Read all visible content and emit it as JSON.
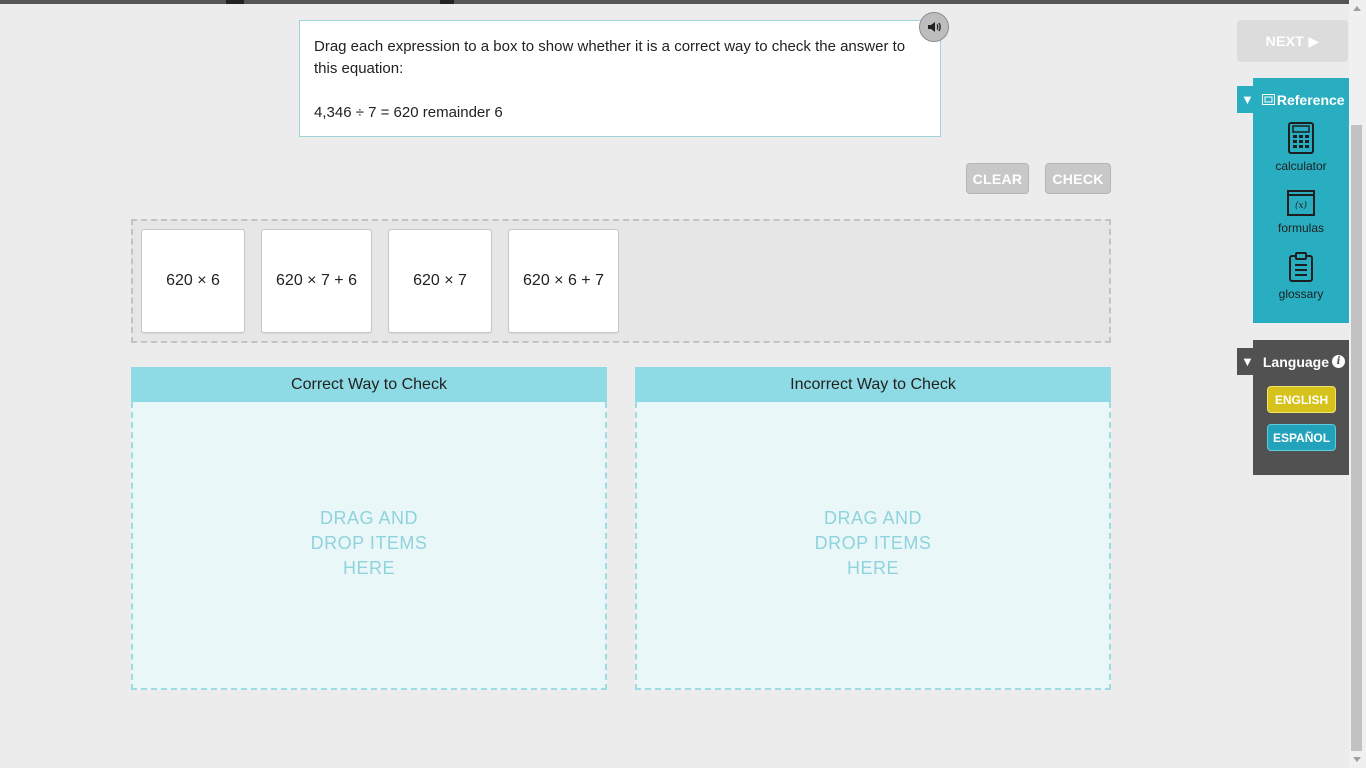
{
  "prompt": {
    "instruction": "Drag each expression to a box to show whether it is a correct way to check the answer to this equation:",
    "equation": "4,346 ÷ 7 = 620 remainder 6"
  },
  "toolbar": {
    "clear_label": "CLEAR",
    "check_label": "CHECK",
    "next_label": "NEXT ▶"
  },
  "tiles": [
    "620 × 6",
    "620 × 7 + 6",
    "620 × 7",
    "620 × 6 + 7"
  ],
  "zones": {
    "correct": {
      "title": "Correct Way to Check",
      "hint": "DRAG AND DROP ITEMS HERE"
    },
    "incorrect": {
      "title": "Incorrect Way to Check",
      "hint": "DRAG AND DROP ITEMS HERE"
    }
  },
  "reference": {
    "title": "Reference",
    "items": [
      {
        "label": "calculator",
        "icon": "calculator-icon"
      },
      {
        "label": "formulas",
        "icon": "formulas-icon"
      },
      {
        "label": "glossary",
        "icon": "glossary-icon"
      }
    ]
  },
  "language": {
    "title": "Language",
    "options": [
      "ENGLISH",
      "ESPAÑOL"
    ],
    "selected": "ENGLISH"
  },
  "colors": {
    "accent": "#29aec1",
    "zone_header": "#8fdbe5",
    "english_button": "#d6c21a",
    "espanol_button": "#23a2bb",
    "disabled_button": "#c8c8c8"
  }
}
